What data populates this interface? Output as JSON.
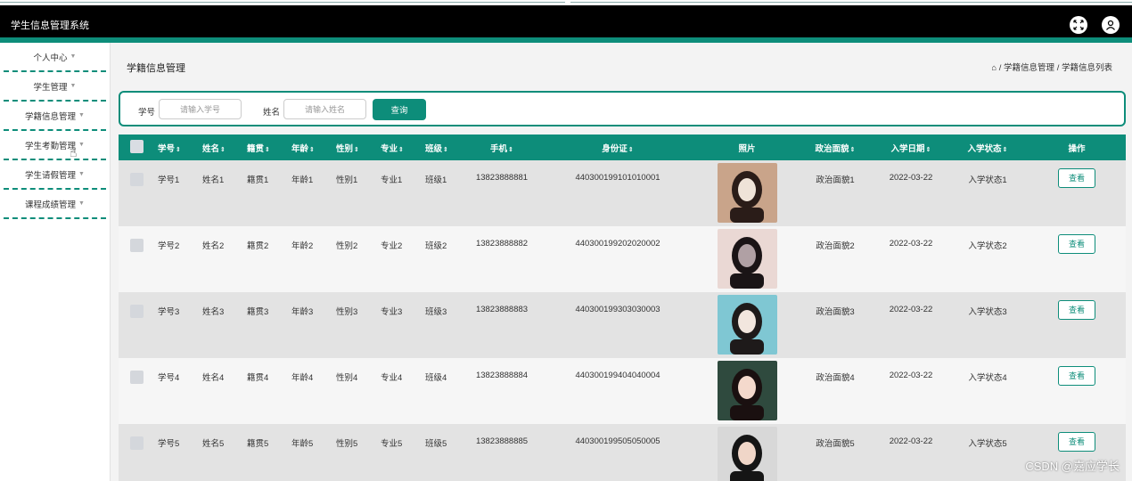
{
  "app": {
    "title": "学生信息管理系统"
  },
  "header_icons": {
    "fullscreen": "fullscreen-icon",
    "user": "user-avatar-icon"
  },
  "sidebar": {
    "items": [
      {
        "label": "个人中心"
      },
      {
        "label": "学生管理"
      },
      {
        "label": "学籍信息管理"
      },
      {
        "label": "学生考勤管理"
      },
      {
        "label": "学生请假管理"
      },
      {
        "label": "课程成绩管理"
      }
    ]
  },
  "page": {
    "title": "学籍信息管理"
  },
  "breadcrumb": {
    "home_icon": "home-icon",
    "level1": "学籍信息管理",
    "sep": "/",
    "level2": "学籍信息列表"
  },
  "search": {
    "student_no_label": "学号",
    "student_no_placeholder": "请输入学号",
    "name_label": "姓名",
    "name_placeholder": "请输入姓名",
    "button_label": "查询"
  },
  "table": {
    "columns": [
      "学号",
      "姓名",
      "籍贯",
      "年龄",
      "性别",
      "专业",
      "班级",
      "手机",
      "身份证",
      "照片",
      "政治面貌",
      "入学日期",
      "入学状态",
      "操作"
    ],
    "rows": [
      {
        "cells": [
          "学号1",
          "姓名1",
          "籍贯1",
          "年龄1",
          "性别1",
          "专业1",
          "班级1",
          "13823888881",
          "440300199101010001",
          "政治面貌1",
          "2022-03-22",
          "入学状态1"
        ],
        "action": "查看"
      },
      {
        "cells": [
          "学号2",
          "姓名2",
          "籍贯2",
          "年龄2",
          "性别2",
          "专业2",
          "班级2",
          "13823888882",
          "440300199202020002",
          "政治面貌2",
          "2022-03-22",
          "入学状态2"
        ],
        "action": "查看"
      },
      {
        "cells": [
          "学号3",
          "姓名3",
          "籍贯3",
          "年龄3",
          "性别3",
          "专业3",
          "班级3",
          "13823888883",
          "440300199303030003",
          "政治面貌3",
          "2022-03-22",
          "入学状态3"
        ],
        "action": "查看"
      },
      {
        "cells": [
          "学号4",
          "姓名4",
          "籍贯4",
          "年龄4",
          "性别4",
          "专业4",
          "班级4",
          "13823888884",
          "440300199404040004",
          "政治面貌4",
          "2022-03-22",
          "入学状态4"
        ],
        "action": "查看"
      },
      {
        "cells": [
          "学号5",
          "姓名5",
          "籍贯5",
          "年龄5",
          "性别5",
          "专业5",
          "班级5",
          "13823888885",
          "440300199505050005",
          "政治面貌5",
          "2022-03-22",
          "入学状态5"
        ],
        "action": "查看"
      }
    ]
  },
  "watermark": "CSDN @嘉应学长",
  "colors": {
    "accent": "#0d8d7a",
    "header": "#000000"
  }
}
